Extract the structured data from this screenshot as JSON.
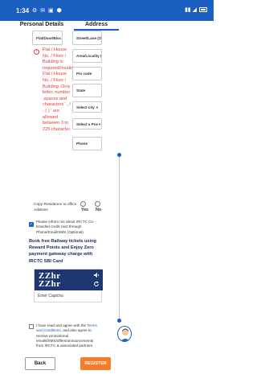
{
  "status_bar": {
    "time": "1:34",
    "left_icons": "⚙ ✉ ▣ ⬢",
    "right_icons": "▮▮ ◢"
  },
  "tabs": [
    {
      "label": "Personal Details",
      "active": false
    },
    {
      "label": "Address",
      "active": true
    }
  ],
  "form": {
    "flat_placeholder": "Flat/Door/Bloc",
    "street_placeholder": "Street/Lane (O",
    "area_placeholder": "Area/Locality (",
    "pincode_placeholder": "Pin code",
    "state_placeholder": "State",
    "city_select": "Select city",
    "post_office_select": "Select a Pos",
    "phone_placeholder": "Phone",
    "error_message": "Flat / House No. / Floor / Building is required/Invalid Flat / House No. / Floor / Building .Only letter, number ,spaces and characters ' , / - ( ) ' are allowed between 3 to 225 character."
  },
  "copy_address": {
    "label": "Copy Residence to office Address",
    "yes_label": "Yes",
    "no_label": "No"
  },
  "credit_card_consent": {
    "checked": true,
    "text": "Please inform me about IRCTC Co-branded credit card through Phone/Email/SMS (Optional)"
  },
  "promo": {
    "text": "Book free Railway tickets using Reward Points and Enjoy Zero payment gateway charge with IRCTC SBI Card"
  },
  "captcha": {
    "line1": "ZZhr",
    "line2": "ZZhr",
    "input_placeholder": "Enter Captcha"
  },
  "terms": {
    "checked": false,
    "prefix": "I have read and agree with the ",
    "link_text": "Terms and Conditions",
    "suffix": ", and also agree to receive promotional emails/SMS/offers/announcements from IRCTC & associated partners"
  },
  "buttons": {
    "back_label": "Back",
    "register_label": "REGISTER"
  },
  "colors": {
    "primary": "#1b5fc0",
    "error": "#e53935",
    "accent": "#f57c2a",
    "captcha_bg": "#1f3770"
  }
}
